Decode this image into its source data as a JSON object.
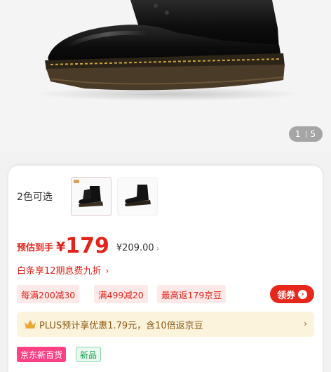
{
  "gallery": {
    "current": "1",
    "total": "5",
    "image": "black-leather-boot"
  },
  "colors": {
    "label": "2色可选",
    "options": [
      {
        "name": "boot-variant-1",
        "selected": true
      },
      {
        "name": "boot-variant-2",
        "selected": false
      }
    ]
  },
  "price": {
    "tag": "预估到手",
    "symbol": "¥",
    "amount": "179",
    "original": "¥209.00",
    "original_arrow": "›"
  },
  "installment": {
    "text": "白条享12期息费九折",
    "arrow": "›"
  },
  "coupons": [
    "每满200减30",
    "满499减20",
    "最高返179京豆"
  ],
  "coupon_button": {
    "label": "领券",
    "icon": "chevron-right-icon"
  },
  "plus": {
    "text": "PLUS预计享优惠1.79元，含10倍返京豆",
    "icon": "crown-icon",
    "arrow": "›"
  },
  "badges": [
    "京东新百货",
    "新品"
  ],
  "theme": {
    "accent": "#e2231a",
    "plus_bg": "#fcf3dc",
    "plus_text": "#8a5a14"
  }
}
